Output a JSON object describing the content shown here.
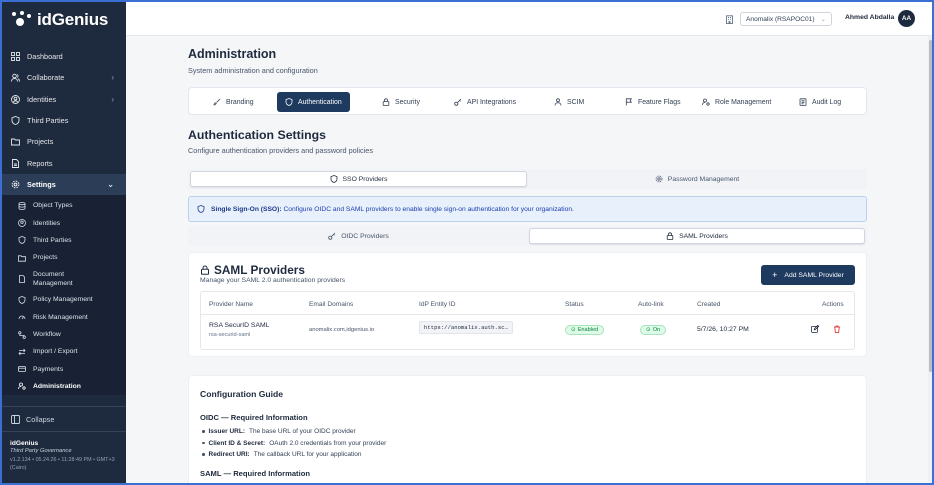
{
  "app": {
    "name": "idGenius"
  },
  "sidebar": {
    "items": [
      {
        "label": "Dashboard",
        "icon": "dashboard-icon",
        "chevron": false
      },
      {
        "label": "Collaborate",
        "icon": "users-icon",
        "chevron": true
      },
      {
        "label": "Identities",
        "icon": "identity-icon",
        "chevron": true
      },
      {
        "label": "Third Parties",
        "icon": "shield-icon",
        "chevron": false
      },
      {
        "label": "Projects",
        "icon": "folder-icon",
        "chevron": false
      },
      {
        "label": "Reports",
        "icon": "file-icon",
        "chevron": false
      },
      {
        "label": "Settings",
        "icon": "gear-icon",
        "chevron": true,
        "active": true
      }
    ],
    "settings_items": [
      {
        "label": "Object Types"
      },
      {
        "label": "Identities"
      },
      {
        "label": "Third Parties"
      },
      {
        "label": "Projects"
      },
      {
        "label": "Document Management"
      },
      {
        "label": "Policy Management"
      },
      {
        "label": "Risk Management"
      },
      {
        "label": "Workflow"
      },
      {
        "label": "Import / Export"
      },
      {
        "label": "Payments"
      },
      {
        "label": "Administration",
        "active": true
      }
    ],
    "collapse_label": "Collapse",
    "footer": {
      "name": "idGenius",
      "subtitle": "Third Party Governance",
      "version": "v1.2.134 • 05.24.26 • 11:28:49 PM • GMT+3 (Cairo)"
    }
  },
  "topbar": {
    "org": "Anomalix (RSAPOC01)",
    "user_name": "Ahmed Abdalla",
    "avatar_initials": "AA"
  },
  "page": {
    "title": "Administration",
    "subtitle": "System administration and configuration"
  },
  "admin_tabs": [
    {
      "label": "Branding",
      "icon": "brush-icon"
    },
    {
      "label": "Authentication",
      "icon": "shield-icon",
      "active": true
    },
    {
      "label": "Security",
      "icon": "lock-icon"
    },
    {
      "label": "API Integrations",
      "icon": "key-icon"
    },
    {
      "label": "SCIM",
      "icon": "users-icon"
    },
    {
      "label": "Feature Flags",
      "icon": "flag-icon"
    },
    {
      "label": "Role Management",
      "icon": "user-cog-icon"
    },
    {
      "label": "Audit Log",
      "icon": "log-icon"
    }
  ],
  "auth": {
    "title": "Authentication Settings",
    "subtitle": "Configure authentication providers and password policies",
    "segments": [
      "SSO Providers",
      "Password Management"
    ],
    "info_bold": "Single Sign-On (SSO):",
    "info_text": "Configure OIDC and SAML providers to enable single sign-on authentication for your organization.",
    "provider_tabs": [
      "OIDC Providers",
      "SAML Providers"
    ]
  },
  "saml": {
    "title": "SAML Providers",
    "subtitle": "Manage your SAML 2.0 authentication providers",
    "add_button": "Add SAML Provider",
    "columns": [
      "Provider Name",
      "Email Domains",
      "IdP Entity ID",
      "Status",
      "Auto-link",
      "Created",
      "Actions"
    ],
    "rows": [
      {
        "name": "RSA SecurID SAML",
        "slug": "rsa-securid-saml",
        "domains": "anomalix.com,idgenius.io",
        "entity_id": "https://anomalix.auth.sc…",
        "status": "Enabled",
        "auto_link": "On",
        "created": "5/7/26, 10:27 PM"
      }
    ]
  },
  "guide": {
    "title": "Configuration Guide",
    "oidc_heading": "OIDC — Required Information",
    "oidc_items": [
      {
        "bold": "Issuer URL:",
        "text": "The base URL of your OIDC provider"
      },
      {
        "bold": "Client ID & Secret:",
        "text": "OAuth 2.0 credentials from your provider"
      },
      {
        "bold": "Redirect URI:",
        "text": "The callback URL for your application"
      }
    ],
    "saml_heading": "SAML — Required Information"
  },
  "colors": {
    "sidebar_bg": "#1e2a3d",
    "accent": "#1e3a5f",
    "info_bg": "#e8f0fb",
    "success": "#15803d",
    "danger": "#dc2626"
  }
}
